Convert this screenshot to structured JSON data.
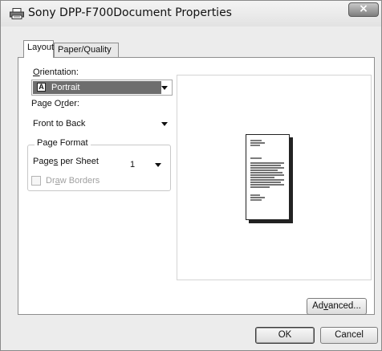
{
  "window": {
    "title": "Sony DPP-F700Document Properties"
  },
  "tabs": [
    {
      "label": "Layout",
      "active": true
    },
    {
      "label": "Paper/Quality",
      "active": false
    }
  ],
  "layout": {
    "orientation_label_pre": "",
    "orientation_label_key": "O",
    "orientation_label_post": "rientation:",
    "orientation_value": "Portrait",
    "page_order_label_pre": "Page O",
    "page_order_label_key": "r",
    "page_order_label_post": "der:",
    "page_order_value": "Front to Back",
    "page_format_title": "Page Format",
    "pages_per_sheet_label_pre": "Page",
    "pages_per_sheet_label_key": "s",
    "pages_per_sheet_label_post": " per Sheet",
    "pages_per_sheet_value": "1",
    "draw_borders_pre": "Dr",
    "draw_borders_key": "a",
    "draw_borders_post": "w Borders",
    "draw_borders_checked": false
  },
  "buttons": {
    "advanced_pre": "Ad",
    "advanced_key": "v",
    "advanced_post": "anced...",
    "ok": "OK",
    "cancel": "Cancel"
  },
  "icons": {
    "title": "printer-icon",
    "close": "close-icon",
    "orientation": "portrait-page-icon"
  }
}
